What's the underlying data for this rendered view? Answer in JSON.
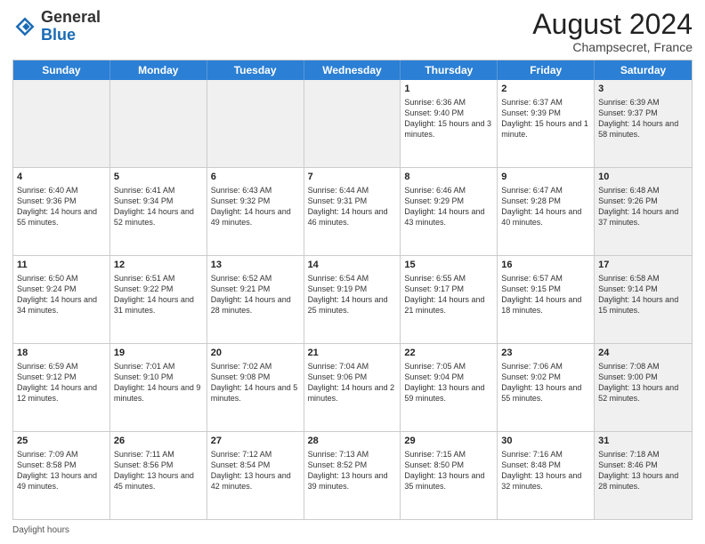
{
  "header": {
    "logo_general": "General",
    "logo_blue": "Blue",
    "month_year": "August 2024",
    "location": "Champsecret, France"
  },
  "days_of_week": [
    "Sunday",
    "Monday",
    "Tuesday",
    "Wednesday",
    "Thursday",
    "Friday",
    "Saturday"
  ],
  "footer": {
    "daylight_hours": "Daylight hours"
  },
  "weeks": [
    [
      {
        "day": "",
        "info": "",
        "shaded": true
      },
      {
        "day": "",
        "info": "",
        "shaded": true
      },
      {
        "day": "",
        "info": "",
        "shaded": true
      },
      {
        "day": "",
        "info": "",
        "shaded": true
      },
      {
        "day": "1",
        "info": "Sunrise: 6:36 AM\nSunset: 9:40 PM\nDaylight: 15 hours and 3 minutes.",
        "shaded": false
      },
      {
        "day": "2",
        "info": "Sunrise: 6:37 AM\nSunset: 9:39 PM\nDaylight: 15 hours and 1 minute.",
        "shaded": false
      },
      {
        "day": "3",
        "info": "Sunrise: 6:39 AM\nSunset: 9:37 PM\nDaylight: 14 hours and 58 minutes.",
        "shaded": true
      }
    ],
    [
      {
        "day": "4",
        "info": "Sunrise: 6:40 AM\nSunset: 9:36 PM\nDaylight: 14 hours and 55 minutes.",
        "shaded": false
      },
      {
        "day": "5",
        "info": "Sunrise: 6:41 AM\nSunset: 9:34 PM\nDaylight: 14 hours and 52 minutes.",
        "shaded": false
      },
      {
        "day": "6",
        "info": "Sunrise: 6:43 AM\nSunset: 9:32 PM\nDaylight: 14 hours and 49 minutes.",
        "shaded": false
      },
      {
        "day": "7",
        "info": "Sunrise: 6:44 AM\nSunset: 9:31 PM\nDaylight: 14 hours and 46 minutes.",
        "shaded": false
      },
      {
        "day": "8",
        "info": "Sunrise: 6:46 AM\nSunset: 9:29 PM\nDaylight: 14 hours and 43 minutes.",
        "shaded": false
      },
      {
        "day": "9",
        "info": "Sunrise: 6:47 AM\nSunset: 9:28 PM\nDaylight: 14 hours and 40 minutes.",
        "shaded": false
      },
      {
        "day": "10",
        "info": "Sunrise: 6:48 AM\nSunset: 9:26 PM\nDaylight: 14 hours and 37 minutes.",
        "shaded": true
      }
    ],
    [
      {
        "day": "11",
        "info": "Sunrise: 6:50 AM\nSunset: 9:24 PM\nDaylight: 14 hours and 34 minutes.",
        "shaded": false
      },
      {
        "day": "12",
        "info": "Sunrise: 6:51 AM\nSunset: 9:22 PM\nDaylight: 14 hours and 31 minutes.",
        "shaded": false
      },
      {
        "day": "13",
        "info": "Sunrise: 6:52 AM\nSunset: 9:21 PM\nDaylight: 14 hours and 28 minutes.",
        "shaded": false
      },
      {
        "day": "14",
        "info": "Sunrise: 6:54 AM\nSunset: 9:19 PM\nDaylight: 14 hours and 25 minutes.",
        "shaded": false
      },
      {
        "day": "15",
        "info": "Sunrise: 6:55 AM\nSunset: 9:17 PM\nDaylight: 14 hours and 21 minutes.",
        "shaded": false
      },
      {
        "day": "16",
        "info": "Sunrise: 6:57 AM\nSunset: 9:15 PM\nDaylight: 14 hours and 18 minutes.",
        "shaded": false
      },
      {
        "day": "17",
        "info": "Sunrise: 6:58 AM\nSunset: 9:14 PM\nDaylight: 14 hours and 15 minutes.",
        "shaded": true
      }
    ],
    [
      {
        "day": "18",
        "info": "Sunrise: 6:59 AM\nSunset: 9:12 PM\nDaylight: 14 hours and 12 minutes.",
        "shaded": false
      },
      {
        "day": "19",
        "info": "Sunrise: 7:01 AM\nSunset: 9:10 PM\nDaylight: 14 hours and 9 minutes.",
        "shaded": false
      },
      {
        "day": "20",
        "info": "Sunrise: 7:02 AM\nSunset: 9:08 PM\nDaylight: 14 hours and 5 minutes.",
        "shaded": false
      },
      {
        "day": "21",
        "info": "Sunrise: 7:04 AM\nSunset: 9:06 PM\nDaylight: 14 hours and 2 minutes.",
        "shaded": false
      },
      {
        "day": "22",
        "info": "Sunrise: 7:05 AM\nSunset: 9:04 PM\nDaylight: 13 hours and 59 minutes.",
        "shaded": false
      },
      {
        "day": "23",
        "info": "Sunrise: 7:06 AM\nSunset: 9:02 PM\nDaylight: 13 hours and 55 minutes.",
        "shaded": false
      },
      {
        "day": "24",
        "info": "Sunrise: 7:08 AM\nSunset: 9:00 PM\nDaylight: 13 hours and 52 minutes.",
        "shaded": true
      }
    ],
    [
      {
        "day": "25",
        "info": "Sunrise: 7:09 AM\nSunset: 8:58 PM\nDaylight: 13 hours and 49 minutes.",
        "shaded": false
      },
      {
        "day": "26",
        "info": "Sunrise: 7:11 AM\nSunset: 8:56 PM\nDaylight: 13 hours and 45 minutes.",
        "shaded": false
      },
      {
        "day": "27",
        "info": "Sunrise: 7:12 AM\nSunset: 8:54 PM\nDaylight: 13 hours and 42 minutes.",
        "shaded": false
      },
      {
        "day": "28",
        "info": "Sunrise: 7:13 AM\nSunset: 8:52 PM\nDaylight: 13 hours and 39 minutes.",
        "shaded": false
      },
      {
        "day": "29",
        "info": "Sunrise: 7:15 AM\nSunset: 8:50 PM\nDaylight: 13 hours and 35 minutes.",
        "shaded": false
      },
      {
        "day": "30",
        "info": "Sunrise: 7:16 AM\nSunset: 8:48 PM\nDaylight: 13 hours and 32 minutes.",
        "shaded": false
      },
      {
        "day": "31",
        "info": "Sunrise: 7:18 AM\nSunset: 8:46 PM\nDaylight: 13 hours and 28 minutes.",
        "shaded": true
      }
    ]
  ]
}
